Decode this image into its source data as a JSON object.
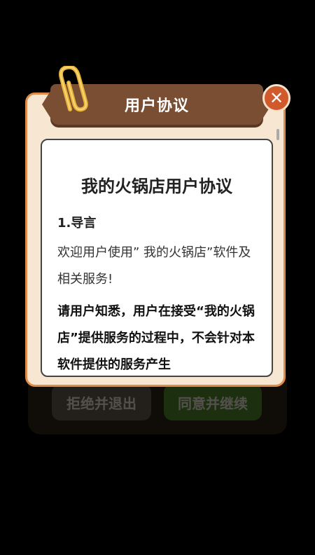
{
  "background_buttons": {
    "reject_label": "拒绝并退出",
    "agree_label": "同意并继续"
  },
  "dialog": {
    "title": "用户协议",
    "close_icon": "close-icon",
    "agreement_title": "我的火锅店用户协议",
    "section_heading": "1.导言",
    "paragraph1": "欢迎用户使用” 我的火锅店”软件及相关服务!",
    "paragraph2": "请用户知悉，用户在接受“我的火锅店”提供服务的过程中，不会针对本软件提供的服务产生"
  },
  "colors": {
    "dialog_bg": "#f7e6d2",
    "dialog_border": "#e08b47",
    "ribbon": "#7a4e33",
    "close_button": "#d15a2d"
  }
}
